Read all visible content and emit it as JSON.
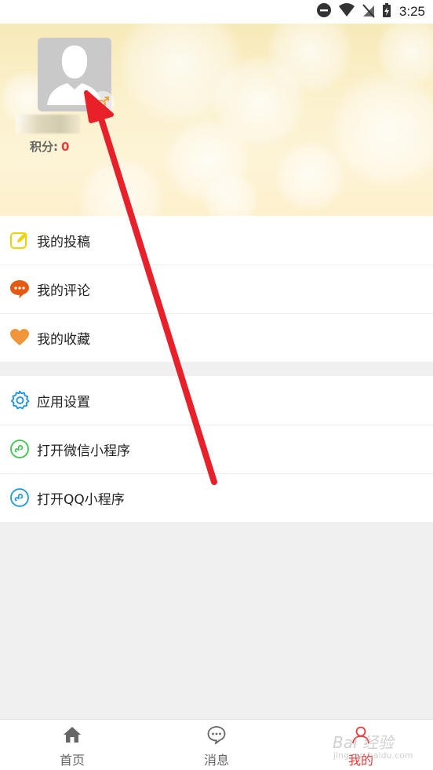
{
  "status_bar": {
    "time": "3:25",
    "icons": [
      "do-not-disturb-icon",
      "wifi-icon",
      "no-signal-icon",
      "battery-charging-icon"
    ]
  },
  "profile": {
    "points_label": "积分:",
    "points_value": "0",
    "gender_icon": "male-icon"
  },
  "menu_primary": [
    {
      "label": "我的投稿",
      "icon": "edit-icon",
      "color": "#f2d100"
    },
    {
      "label": "我的评论",
      "icon": "comment-icon",
      "color": "#e55a12"
    },
    {
      "label": "我的收藏",
      "icon": "heart-icon",
      "color": "#f0953a"
    }
  ],
  "menu_secondary": [
    {
      "label": "应用设置",
      "icon": "gear-icon",
      "color": "#1a8fe3"
    },
    {
      "label": "打开微信小程序",
      "icon": "wechat-miniprogram-icon",
      "color": "#3bc44b"
    },
    {
      "label": "打开QQ小程序",
      "icon": "qq-miniprogram-icon",
      "color": "#1b97e0"
    }
  ],
  "bottom_nav": [
    {
      "label": "首页",
      "icon": "home-icon",
      "active": false
    },
    {
      "label": "消息",
      "icon": "message-icon",
      "active": false
    },
    {
      "label": "我的",
      "icon": "user-icon",
      "active": true
    }
  ],
  "watermark": {
    "text": "Bai 经验",
    "sub": "jingyan.baidu.com"
  },
  "colors": {
    "accent": "#ee3a3a",
    "arrow": "#e8202a"
  }
}
